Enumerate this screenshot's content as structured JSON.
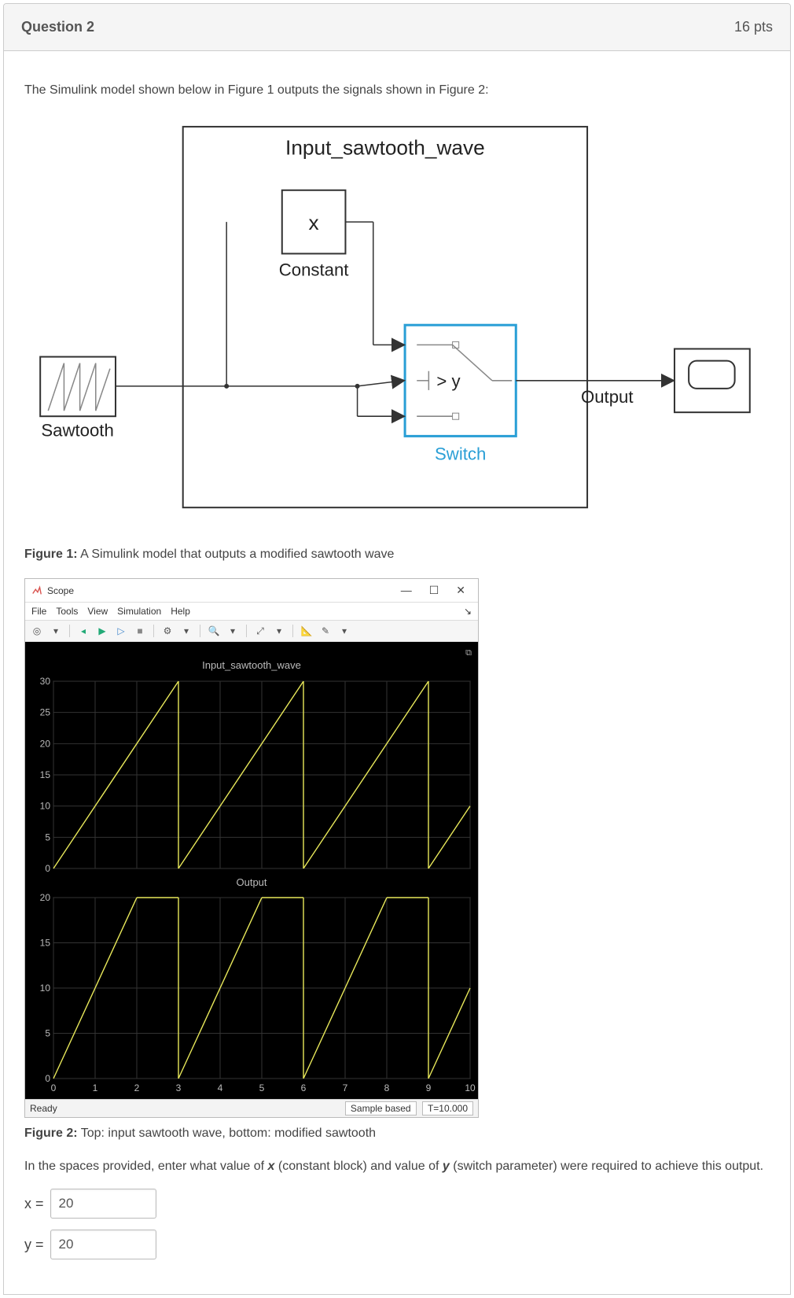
{
  "header": {
    "title": "Question 2",
    "points": "16 pts"
  },
  "prompt": "The Simulink model shown below in Figure 1 outputs the signals shown in Figure 2:",
  "diagram": {
    "title": "Input_sawtooth_wave",
    "constant_symbol": "x",
    "constant_label": "Constant",
    "source_label": "Sawtooth",
    "switch_condition": "> y",
    "switch_label": "Switch",
    "output_label": "Output"
  },
  "fig1_caption_bold": "Figure 1:",
  "fig1_caption_rest": " A Simulink model that outputs a modified sawtooth wave",
  "scope": {
    "window_title": "Scope",
    "menus": [
      "File",
      "Tools",
      "View",
      "Simulation",
      "Help"
    ],
    "plot_title_top": "Input_sawtooth_wave",
    "plot_title_bottom": "Output",
    "status_left": "Ready",
    "status_mid": "Sample based",
    "status_right": "T=10.000"
  },
  "fig2_caption_bold": "Figure 2:",
  "fig2_caption_rest": " Top: input sawtooth wave, bottom: modified sawtooth",
  "instruction_before_x": "In the spaces provided, enter what value of ",
  "instruction_x_bold": "x",
  "instruction_mid": " (constant block) and value of ",
  "instruction_y_bold": "y",
  "instruction_after": " (switch parameter) were required to achieve this output.",
  "answers": {
    "x_label": "x =",
    "x_value": "20",
    "y_label": "y =",
    "y_value": "20"
  },
  "chart_data": [
    {
      "type": "line",
      "title": "Input_sawtooth_wave",
      "xlabel": "",
      "ylabel": "",
      "xlim": [
        0,
        10
      ],
      "ylim": [
        0,
        30
      ],
      "x_ticks": [
        0,
        1,
        2,
        3,
        4,
        5,
        6,
        7,
        8,
        9,
        10
      ],
      "y_ticks": [
        0,
        5,
        10,
        15,
        20,
        25,
        30
      ],
      "series": [
        {
          "name": "Input_sawtooth_wave",
          "segments": [
            {
              "x": [
                0,
                3
              ],
              "y": [
                0,
                30
              ]
            },
            {
              "x": [
                3,
                3
              ],
              "y": [
                30,
                0
              ]
            },
            {
              "x": [
                3,
                6
              ],
              "y": [
                0,
                30
              ]
            },
            {
              "x": [
                6,
                6
              ],
              "y": [
                30,
                0
              ]
            },
            {
              "x": [
                6,
                9
              ],
              "y": [
                0,
                30
              ]
            },
            {
              "x": [
                9,
                9
              ],
              "y": [
                30,
                0
              ]
            },
            {
              "x": [
                9,
                10
              ],
              "y": [
                0,
                10
              ]
            }
          ]
        }
      ]
    },
    {
      "type": "line",
      "title": "Output",
      "xlabel": "",
      "ylabel": "",
      "xlim": [
        0,
        10
      ],
      "ylim": [
        0,
        20
      ],
      "x_ticks": [
        0,
        1,
        2,
        3,
        4,
        5,
        6,
        7,
        8,
        9,
        10
      ],
      "y_ticks": [
        0,
        5,
        10,
        15,
        20
      ],
      "series": [
        {
          "name": "Output",
          "segments": [
            {
              "x": [
                0,
                2
              ],
              "y": [
                0,
                20
              ]
            },
            {
              "x": [
                2,
                3
              ],
              "y": [
                20,
                20
              ]
            },
            {
              "x": [
                3,
                3
              ],
              "y": [
                20,
                0
              ]
            },
            {
              "x": [
                3,
                5
              ],
              "y": [
                0,
                20
              ]
            },
            {
              "x": [
                5,
                6
              ],
              "y": [
                20,
                20
              ]
            },
            {
              "x": [
                6,
                6
              ],
              "y": [
                20,
                0
              ]
            },
            {
              "x": [
                6,
                8
              ],
              "y": [
                0,
                20
              ]
            },
            {
              "x": [
                8,
                9
              ],
              "y": [
                20,
                20
              ]
            },
            {
              "x": [
                9,
                9
              ],
              "y": [
                20,
                0
              ]
            },
            {
              "x": [
                9,
                10
              ],
              "y": [
                0,
                10
              ]
            }
          ]
        }
      ]
    }
  ]
}
